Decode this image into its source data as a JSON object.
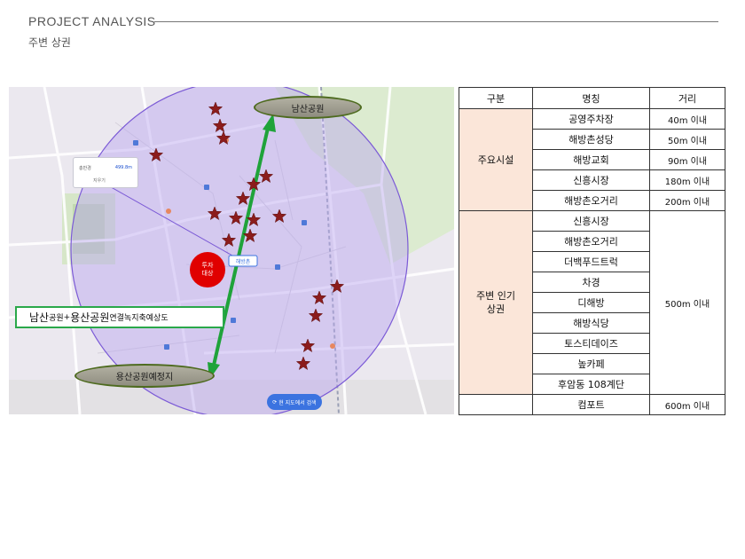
{
  "header": {
    "title": "PROJECT ANALYSIS",
    "subtitle": "주변 상권"
  },
  "map": {
    "oval_top": "남산공원",
    "oval_bottom": "용산공원예정지",
    "investment_marker": "투자\n대상",
    "callout": {
      "part1_big": "남산",
      "part1_small": "공원",
      "plus": " +",
      "part2_big": "용산공원",
      "part3": " 연결녹지축예상도"
    },
    "search_button": "현 지도에서 검색",
    "distance_box": {
      "label": "총반경",
      "value": "499.8m",
      "clear": "지우기"
    },
    "colors": {
      "radius_fill": "#b9a3ef",
      "radius_stroke": "#7b5ad6",
      "star": "#8b1c1c",
      "arrow": "#1fa33a",
      "investment": "#e00000"
    }
  },
  "table": {
    "headers": [
      "구분",
      "명칭",
      "거리"
    ],
    "groups": [
      {
        "category": "주요시설",
        "rows": [
          {
            "name": "공영주차장",
            "distance": "40m 이내"
          },
          {
            "name": "해방촌성당",
            "distance": "50m 이내"
          },
          {
            "name": "해방교회",
            "distance": "90m 이내"
          },
          {
            "name": "신흥시장",
            "distance": "180m 이내"
          },
          {
            "name": "해방촌오거리",
            "distance": "200m 이내"
          }
        ]
      },
      {
        "category": "주변 인기\n상권",
        "shared_distance": "500m 이내",
        "rows": [
          {
            "name": "신흥시장"
          },
          {
            "name": "해방촌오거리"
          },
          {
            "name": "더백푸드트럭"
          },
          {
            "name": "차경"
          },
          {
            "name": "디해방"
          },
          {
            "name": "해방식당"
          },
          {
            "name": "토스티데이즈"
          },
          {
            "name": "높카페"
          },
          {
            "name": "후암동 108계단"
          }
        ]
      }
    ],
    "last_row": {
      "name": "컴포트",
      "distance": "600m 이내"
    }
  }
}
